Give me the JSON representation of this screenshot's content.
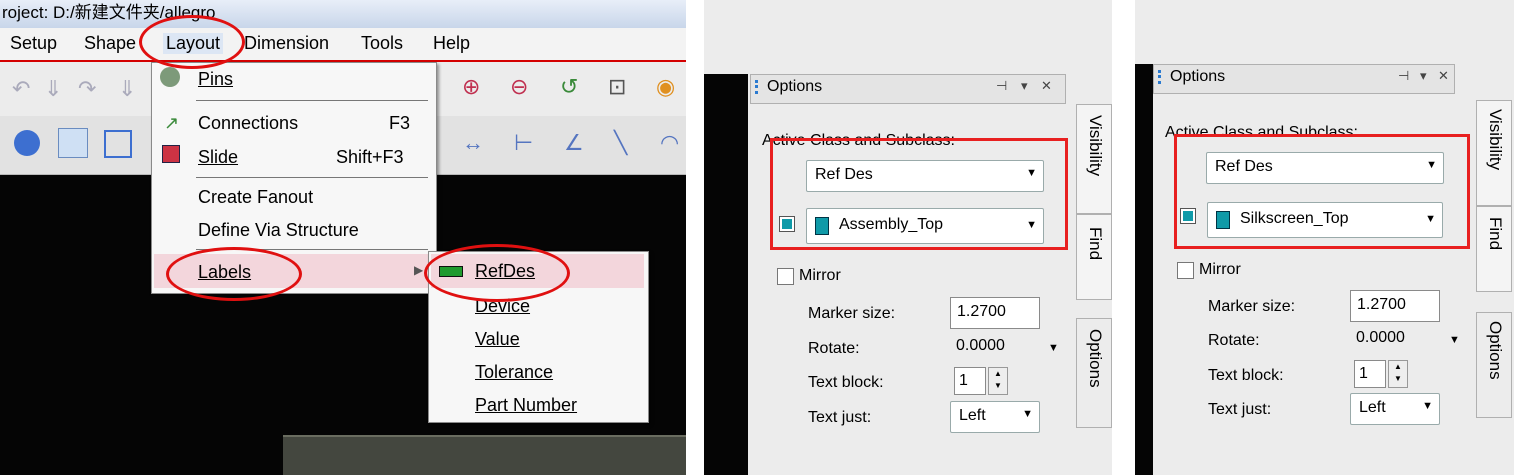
{
  "left": {
    "title": "roject: D:/新建文件夹/allegro",
    "menubar": {
      "setup": "Setup",
      "shape": "Shape",
      "layout": "Layout",
      "dimension": "Dimension",
      "tools": "Tools",
      "help": "Help"
    },
    "layout_menu": {
      "pins": "Pins",
      "connections": "Connections",
      "connections_key": "F3",
      "slide": "Slide",
      "slide_key": "Shift+F3",
      "create_fanout": "Create Fanout",
      "define_via": "Define Via Structure",
      "labels": "Labels"
    },
    "labels_submenu": {
      "refdes": "RefDes",
      "device": "Device",
      "value": "Value",
      "tolerance": "Tolerance",
      "part_number": "Part Number"
    }
  },
  "options_a": {
    "header": "Options",
    "active_class_label": "Active Class and Subclass:",
    "class_value": "Ref Des",
    "subclass_value": "Assembly_Top",
    "mirror": "Mirror",
    "marker_size_label": "Marker size:",
    "marker_size": "1.2700",
    "rotate_label": "Rotate:",
    "rotate": "0.0000",
    "text_block_label": "Text block:",
    "text_block": "1",
    "text_just_label": "Text just:",
    "text_just": "Left",
    "tabs": {
      "visibility": "Visibility",
      "find": "Find",
      "options": "Options"
    }
  },
  "options_b": {
    "header": "Options",
    "active_class_label": "Active Class and Subclass:",
    "class_value": "Ref Des",
    "subclass_value": "Silkscreen_Top",
    "mirror": "Mirror",
    "marker_size_label": "Marker size:",
    "marker_size": "1.2700",
    "rotate_label": "Rotate:",
    "rotate": "0.0000",
    "text_block_label": "Text block:",
    "text_block": "1",
    "text_just_label": "Text just:",
    "text_just": "Left",
    "tabs": {
      "visibility": "Visibility",
      "find": "Find",
      "options": "Options"
    }
  },
  "colors": {
    "highlight": "#e01010",
    "subclass_swatch": "#0f9aa8"
  }
}
